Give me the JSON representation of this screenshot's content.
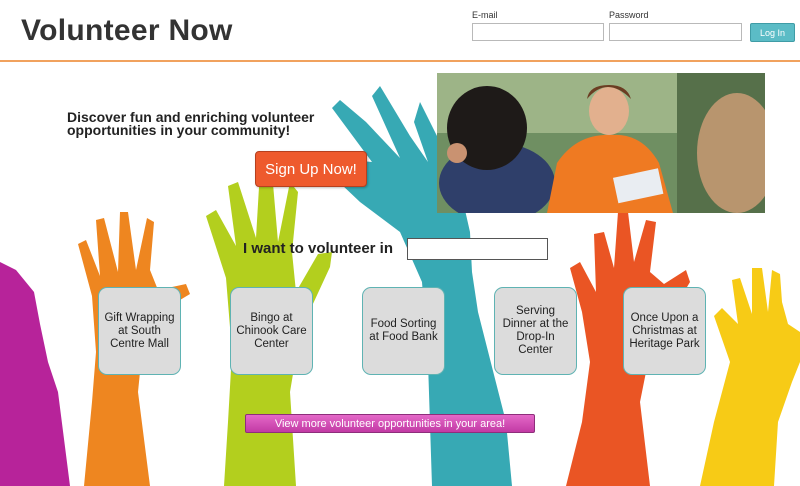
{
  "header": {
    "title": "Volunteer Now",
    "email_label": "E-mail",
    "password_label": "Password",
    "login_label": "Log In"
  },
  "hero": {
    "tagline": "Discover fun and enriching volunteer opportunities in your community!",
    "signup_label": "Sign Up Now!"
  },
  "search": {
    "label": "I want to volunteer in"
  },
  "opportunities": [
    {
      "title": "Gift Wrapping at South Centre Mall"
    },
    {
      "title": "Bingo at Chinook Care Center"
    },
    {
      "title": "Food Sorting at Food Bank"
    },
    {
      "title": "Serving Dinner at the Drop-In Center"
    },
    {
      "title": "Once Upon a Christmas at Heritage Park"
    }
  ],
  "more_label": "View more volunteer opportunities in your area!",
  "colors": {
    "accent_orange": "#ee5a2d",
    "header_rule": "#f1a25e",
    "login_teal": "#5bbcc6",
    "more_magenta": "#d444b4",
    "card_bg": "#dcdcdc"
  }
}
